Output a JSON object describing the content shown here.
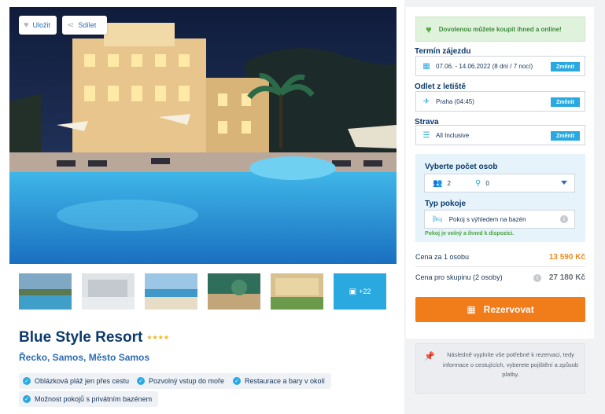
{
  "hero": {
    "save_label": "Uložit",
    "share_label": "Sdílet",
    "save_icon": "heart-icon",
    "share_icon": "share-icon"
  },
  "gallery": {
    "more_label": "+22",
    "more_icon": "image-icon"
  },
  "hotel": {
    "name": "Blue Style Resort",
    "stars": "★★★★",
    "location": "Řecko, Samos, Město Samos",
    "features": [
      "Oblázková pláž jen přes cestu",
      "Pozvolný vstup do moře",
      "Restaurace a bary v okolí",
      "Možnost pokojů s privátním bazénem"
    ]
  },
  "booking": {
    "banner": "Dovolenou můžete koupit ihned a online!",
    "term_label": "Termín zájezdu",
    "term_value": "07.06. - 14.06.2022 (8 dní / 7 nocí)",
    "departure_label": "Odlet z letiště",
    "departure_value": "Praha (04:45)",
    "board_label": "Strava",
    "board_value": "All Inclusive",
    "change_label": "Změnit",
    "persons_label": "Vyberte počet osob",
    "adults": "2",
    "children": "0",
    "room_label": "Typ pokoje",
    "room_value": "Pokoj s výhledem na bazén",
    "room_note": "Pokoj je volný a ihned k dispozici.",
    "price_person_label": "Cena za 1 osobu",
    "price_person_value": "13 590 Kč",
    "price_group_label": "Cena pro skupinu (2 osoby)",
    "price_group_value": "27 180 Kč",
    "reserve_label": "Rezervovat",
    "note": "Následně vyplníte vše potřebné k rezervaci, tedy informace o cestujících, vyberete pojištění a způsob platby."
  },
  "colors": {
    "accent": "#29a9e0",
    "brand_navy": "#0b3a6b",
    "cta": "#f07c1a",
    "success": "#4aa33d"
  }
}
